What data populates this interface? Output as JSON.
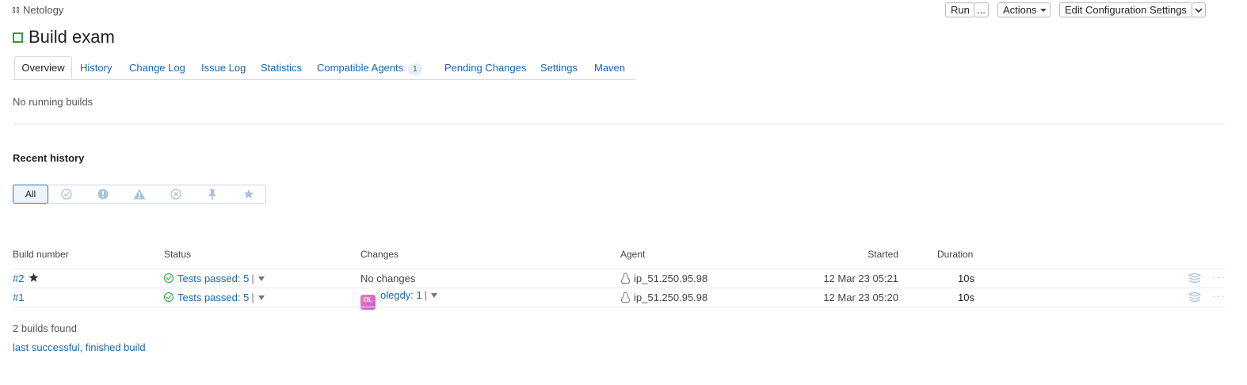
{
  "breadcrumb": {
    "project": "Netology"
  },
  "header": {
    "title": "Build exam",
    "run_label": "Run",
    "run_more_label": "...",
    "actions_label": "Actions",
    "edit_config_label": "Edit Configuration Settings"
  },
  "tabs": [
    {
      "label": "Overview",
      "active": true
    },
    {
      "label": "History"
    },
    {
      "label": "Change Log"
    },
    {
      "label": "Issue Log"
    },
    {
      "label": "Statistics"
    },
    {
      "label": "Compatible Agents",
      "badge": "1"
    },
    {
      "label": "Pending Changes"
    },
    {
      "label": "Settings"
    },
    {
      "label": "Maven"
    }
  ],
  "running_builds_text": "No running builds",
  "recent_history": {
    "title": "Recent history",
    "filters": [
      {
        "label": "All",
        "icon": "all",
        "active": true
      },
      {
        "label": "",
        "icon": "success-icon"
      },
      {
        "label": "",
        "icon": "error-icon"
      },
      {
        "label": "",
        "icon": "warning-icon"
      },
      {
        "label": "",
        "icon": "cancelled-icon"
      },
      {
        "label": "",
        "icon": "pin-icon"
      },
      {
        "label": "",
        "icon": "star-icon"
      }
    ]
  },
  "table": {
    "columns": {
      "build_number": "Build number",
      "status": "Status",
      "changes": "Changes",
      "agent": "Agent",
      "started": "Started",
      "duration": "Duration"
    },
    "rows": [
      {
        "number": "#2",
        "starred": true,
        "status": "Tests passed: 5",
        "changes": "No changes",
        "agent": "ip_51.250.95.98",
        "started": "12 Mar 23 05:21",
        "duration": "10s"
      },
      {
        "number": "#1",
        "starred": false,
        "status": "Tests passed: 5",
        "avatar": "OL",
        "changes": "olegdy: 1",
        "agent": "ip_51.250.95.98",
        "started": "12 Mar 23 05:20",
        "duration": "10s"
      }
    ],
    "separator": "|"
  },
  "footer": {
    "builds_found": "2 builds found",
    "last_link": "last successful, finished build"
  },
  "colors": {
    "link": "#1a66b0",
    "success": "#2e9e3e",
    "filter_icon": "#a9c3dd"
  }
}
